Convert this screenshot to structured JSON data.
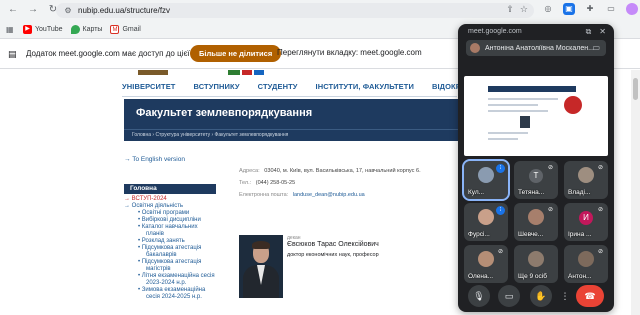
{
  "browser": {
    "url": "nubip.edu.ua/structure/fzv",
    "icons": [
      "back-icon",
      "forward-icon",
      "reload-icon",
      "site-info-icon",
      "share-icon",
      "star-icon"
    ],
    "extensions": [
      "extension-icon",
      "extension-blue-icon",
      "puzzle-icon",
      "media-icon",
      "profile-avatar-icon",
      "menu-icon"
    ]
  },
  "bookmarks": [
    {
      "label": "YouTube",
      "icon": "youtube-icon"
    },
    {
      "label": "Карты",
      "icon": "maps-icon"
    },
    {
      "label": "Gmail",
      "icon": "gmail-icon"
    }
  ],
  "infobar": {
    "message": "Додаток meet.google.com має доступ до цієї вкладки",
    "stop_button": "Більше не ділитися",
    "switch_text": "Переглянути вкладку: meet.google.com"
  },
  "site": {
    "menu": [
      "УНІВЕРСИТЕТ",
      "ВСТУПНИКУ",
      "СТУДЕНТУ",
      "ІНСТИТУТИ, ФАКУЛЬТЕТИ",
      "ВІДОКРЕМЛЕН"
    ],
    "page_title": "Факультет землевпорядкування",
    "breadcrumbs": "Головна › Структура університету › Факультет землевпорядкування",
    "english_link": "→ To English version",
    "sidebar_heading": "Головна",
    "sidebar": [
      {
        "label": "→ ВСТУП-2024",
        "style": "red"
      },
      {
        "label": "→ Освітня діяльність",
        "style": "top"
      },
      {
        "label": "• Освітні програми",
        "style": "sub"
      },
      {
        "label": "• Вибіркові дисципліни",
        "style": "sub"
      },
      {
        "label": "• Каталог навчальних",
        "style": "sub"
      },
      {
        "label": "планів",
        "style": "l2"
      },
      {
        "label": "• Розклад занять",
        "style": "sub"
      },
      {
        "label": "• Підсумкова атестація",
        "style": "sub"
      },
      {
        "label": "бакалаврів",
        "style": "l2"
      },
      {
        "label": "• Підсумкова атестація",
        "style": "sub"
      },
      {
        "label": "магістрів",
        "style": "l2"
      },
      {
        "label": "• Літня екзаменаційна сесія",
        "style": "sub"
      },
      {
        "label": "2023-2024 н.р.",
        "style": "l2"
      },
      {
        "label": "• Зимова екзаменаційна",
        "style": "sub"
      },
      {
        "label": "сесія 2024-2025 н.р.",
        "style": "l2"
      }
    ],
    "contact": {
      "address_label": "Адреса:",
      "address": "03040, м. Київ, вул. Васильківська, 17, навчальний корпус 6.",
      "phone_label": "Тел.:",
      "phone": "(044) 258-05-25",
      "email_label": "Електронна пошта:",
      "email": "landuse_dean@nubip.edu.ua"
    },
    "dean": {
      "role": "декан",
      "name": "Євсюков Тарас Олексійович",
      "title": "доктор економічних наук, професор"
    }
  },
  "meet": {
    "host": "meet.google.com",
    "presenter": "Антоніна Анатоліївна Москален...",
    "tiles": [
      {
        "label": "Кул...",
        "kind": "face",
        "color": "#8a9bb0",
        "indicator": "speaking"
      },
      {
        "label": "Тетяна...",
        "kind": "letter",
        "letter": "Т",
        "color": "#5f6368",
        "indicator": "muted"
      },
      {
        "label": "Владі...",
        "kind": "face",
        "color": "#9e8e80",
        "indicator": "muted"
      },
      {
        "label": "Фурсі...",
        "kind": "face",
        "color": "#c9a08a",
        "indicator": "speaking"
      },
      {
        "label": "Шевче...",
        "kind": "face",
        "color": "#a77f6c",
        "indicator": "muted"
      },
      {
        "label": "Ірина ...",
        "kind": "letter",
        "letter": "И",
        "color": "#c2185b",
        "indicator": "muted"
      },
      {
        "label": "Олена...",
        "kind": "face",
        "color": "#b58e76",
        "indicator": "muted"
      },
      {
        "label": "Ще 9 осіб",
        "kind": "group",
        "color": "#8d7b6d",
        "indicator": "none"
      },
      {
        "label": "Антон...",
        "kind": "face",
        "color": "#7d6a5c",
        "indicator": "muted"
      }
    ],
    "controls": [
      "microphone-icon",
      "camera-icon",
      "raise-hand-icon",
      "more-options-icon",
      "end-call-icon"
    ]
  },
  "colors": {
    "site_navy": "#1e3a5f",
    "site_link": "#1f5b96",
    "stop_button": "#b06000",
    "meet_bg": "#202124",
    "end_call": "#ea4335",
    "speaking": "#1a73e8"
  }
}
